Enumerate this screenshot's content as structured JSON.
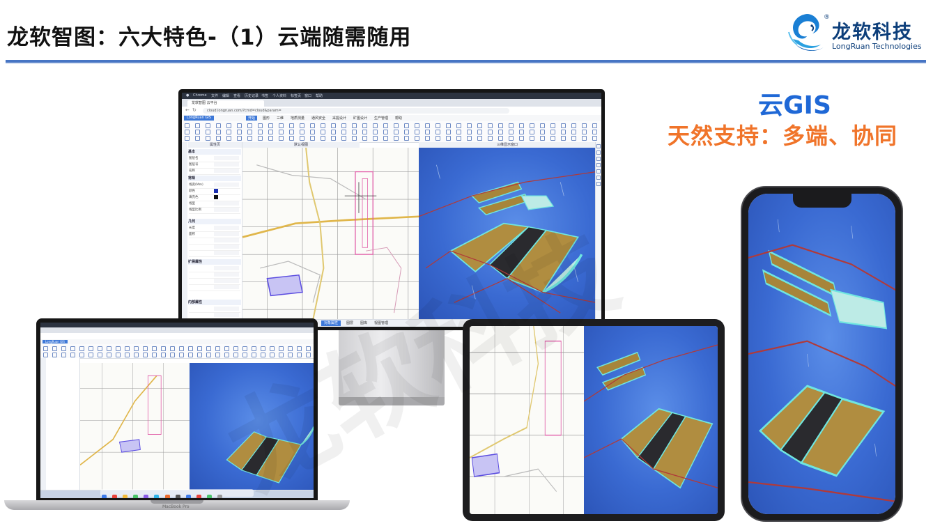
{
  "slide": {
    "title": "龙软智图：六大特色-（1）云端随需随用"
  },
  "logo": {
    "name_cn": "龙软科技",
    "name_en": "LongRuan Technologies",
    "registered_mark": "®"
  },
  "callout": {
    "headline": "云GIS",
    "subline": "天然支持：多端、协同"
  },
  "watermark": "龙软科技",
  "colors": {
    "rule": "#4775c4",
    "headline": "#1f68d6",
    "subline": "#f0742a",
    "scene_bg": "#3a6ad2",
    "app_accent": "#3d78d8"
  },
  "app": {
    "mac_menu": [
      "Chrome",
      "文件",
      "编辑",
      "查看",
      "历史记录",
      "书签",
      "个人资料",
      "标签页",
      "窗口",
      "帮助"
    ],
    "browser_tab": "龙软智图 云平台",
    "url": "cloud.longruan.com/?cmd=cloud&param=",
    "brand_button": "LongRuan GIS",
    "menus": [
      "开始",
      "图形",
      "三维",
      "地质测量",
      "通风安全",
      "采掘设计",
      "矿图设计",
      "生产管理",
      "帮助"
    ],
    "active_menu": "开始",
    "panel_tab": "属性页",
    "pane_2d_title": "默认视图",
    "pane_3d_title": "三维显示窗口",
    "panel_sections": [
      "基本",
      "常规",
      "几何",
      "扩展属性",
      "内部属性"
    ],
    "panel_rows": [
      "图层名",
      "图层号",
      "名称",
      "线宽(Mm)",
      "颜色",
      "填充色",
      "线型",
      "线型比例",
      "长度",
      "面积"
    ],
    "status_tabs": [
      "对象属性",
      "图层",
      "图库",
      "视图管理"
    ],
    "active_status_tab": "对象属性",
    "laptop_label": "MacBook Pro"
  }
}
